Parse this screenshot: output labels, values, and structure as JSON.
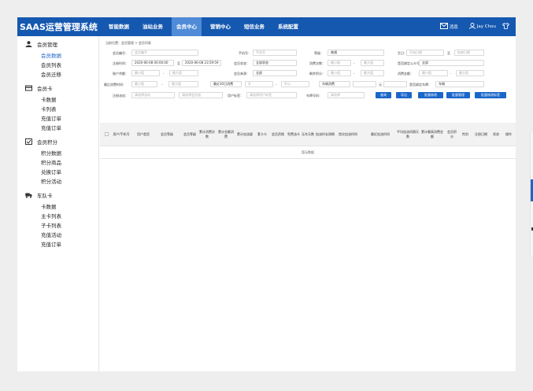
{
  "brand": "SAAS运营管理系统",
  "nav": [
    "智能数据",
    "油站业务",
    "会员中心",
    "营销中心",
    "短信业务",
    "系统配置"
  ],
  "header": {
    "msg": "消息",
    "user": "Jay Chou"
  },
  "sidebar": {
    "groups": [
      {
        "label": "会员管理",
        "items": [
          "会员数据",
          "会员列表",
          "会员迁移"
        ]
      },
      {
        "label": "会员卡",
        "items": [
          "卡数据",
          "卡列表",
          "充值订单",
          "充值订单"
        ]
      },
      {
        "label": "会员积分",
        "items": [
          "积分数据",
          "积分商品",
          "兑换订单",
          "积分活动"
        ]
      },
      {
        "label": "车队卡",
        "items": [
          "卡数据",
          "主卡列表",
          "子卡列表",
          "充值活动",
          "充值订单"
        ]
      }
    ]
  },
  "breadcrumb": "当前位置：会员管理 > 会员列表",
  "filters": {
    "member_no": {
      "label": "会员编号：",
      "placeholder": "会员编号"
    },
    "phone": {
      "label": "手机号：",
      "placeholder": "手机号"
    },
    "level": {
      "label": "等级：",
      "value": "普通"
    },
    "birthday": {
      "label": "生日：",
      "start": "开始日期",
      "sep": "至",
      "end": "结束日期"
    },
    "reg_time": {
      "label": "注册时间：",
      "start": "2020-06-08 00:00:00",
      "sep": "至",
      "end": "2020-06-08 23:59:59"
    },
    "member_status": {
      "label": "会员状态：",
      "value": "全部状态"
    },
    "consume_count": {
      "label": "消费次数：",
      "min": "最小值",
      "sep": "-",
      "max": "最大值"
    },
    "wechat": {
      "label": "是否绑定公众号：",
      "value": "全部"
    },
    "balance": {
      "label": "账户余额：",
      "min": "最小值",
      "sep": "-",
      "max": "最大值"
    },
    "source": {
      "label": "会员来源：",
      "value": "全部"
    },
    "points": {
      "label": "剩余积分：",
      "min": "最小值",
      "sep": "-",
      "max": "最大值"
    },
    "consume_amount": {
      "label": "消费金额：",
      "min": "最小值",
      "sep": "-",
      "max": "最大值"
    },
    "last_consume": {
      "label": "最后消费时间：",
      "min": "最小值",
      "sep": "-",
      "max": "最大值"
    },
    "date_select": {
      "value": "最近30日消费",
      "unit1": "升",
      "sep": "-",
      "unit2": "升以"
    },
    "amount_select": {
      "value": "车辆消费",
      "sep": "元",
      "flag_label": "是否绑定车牌：",
      "flag_value": "车辆"
    },
    "station": {
      "label": "注册油站：",
      "placeholder": "请选择油站"
    },
    "station_group": {
      "placeholder": "请选择会员组"
    },
    "tags": {
      "label": "用户标签：",
      "placeholder": "请选择用户标签"
    },
    "plate": {
      "label": "车牌号码：",
      "placeholder": "请选择"
    }
  },
  "actions": [
    "查询",
    "导出",
    "批量修改",
    "批量管理",
    "批量修改标签"
  ],
  "table": {
    "headers": [
      "用户/手机号",
      "用户类型",
      "会员等级",
      "会员等级",
      "累计消费次数",
      "累计金额消费",
      "累计加油量",
      "套卡卡",
      "会员资格",
      "免费油卡",
      "无车天数",
      "加油时长周期",
      "首次加油时间",
      "最近加油时间",
      "平均加油间隔天数",
      "累计最高消费金额",
      "会员积分",
      "性别",
      "注册日期",
      "状态",
      "操作"
    ],
    "empty": "暂无数据"
  },
  "colors": {
    "topbar": "#1558b0",
    "active_nav": "#4f8bd6",
    "accent": "#1a66c9"
  }
}
